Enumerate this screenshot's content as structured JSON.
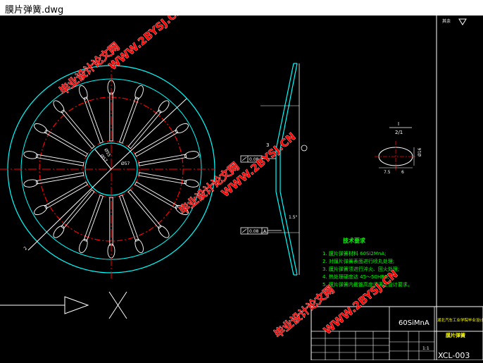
{
  "window": {
    "title": "膜片弹簧.dwg"
  },
  "drawing": {
    "dims": {
      "d1": "Ø57",
      "d2": "Ø57",
      "d3": "Ø55",
      "angle": "2",
      "thk": "3",
      "hole_dim": "Ø16",
      "w1": "7.5",
      "w2": "6",
      "detail_label": "I",
      "detail_scale": "2/1",
      "tol_a": "0.08",
      "tol_b": "0.08",
      "tol_ref": "A",
      "chamfer": "1.5°",
      "mark_i": "I",
      "roughness": "其余"
    },
    "tech_notes": {
      "heading": "技术要求",
      "items": [
        "1. 膜片弹簧材料 60Si2MnA;",
        "2. 对膜片弹簧表面进行喷丸处理;",
        "3. 膜片弹簧须进行淬火、回火处理;",
        "4. 热处理硬度达 45～50HRC;",
        "5. 膜片弹簧内截锥高度须满足设计要求。"
      ]
    },
    "title_block": {
      "material": "60SiMnA",
      "school": "湖北汽车工业学院毕业设计",
      "part_name": "膜片弹簧",
      "scale": "1:1",
      "drawing_no": "XCL-003"
    },
    "watermarks": [
      "毕业设计论文网",
      "WWW.2BYSJ.CN"
    ]
  },
  "colors": {
    "background": "#000000",
    "white": "#ffffff",
    "cyan": "#00ffff",
    "red": "#ff0000",
    "green": "#00ff00",
    "yellow": "#ffff00",
    "blue": "#0000ff"
  }
}
